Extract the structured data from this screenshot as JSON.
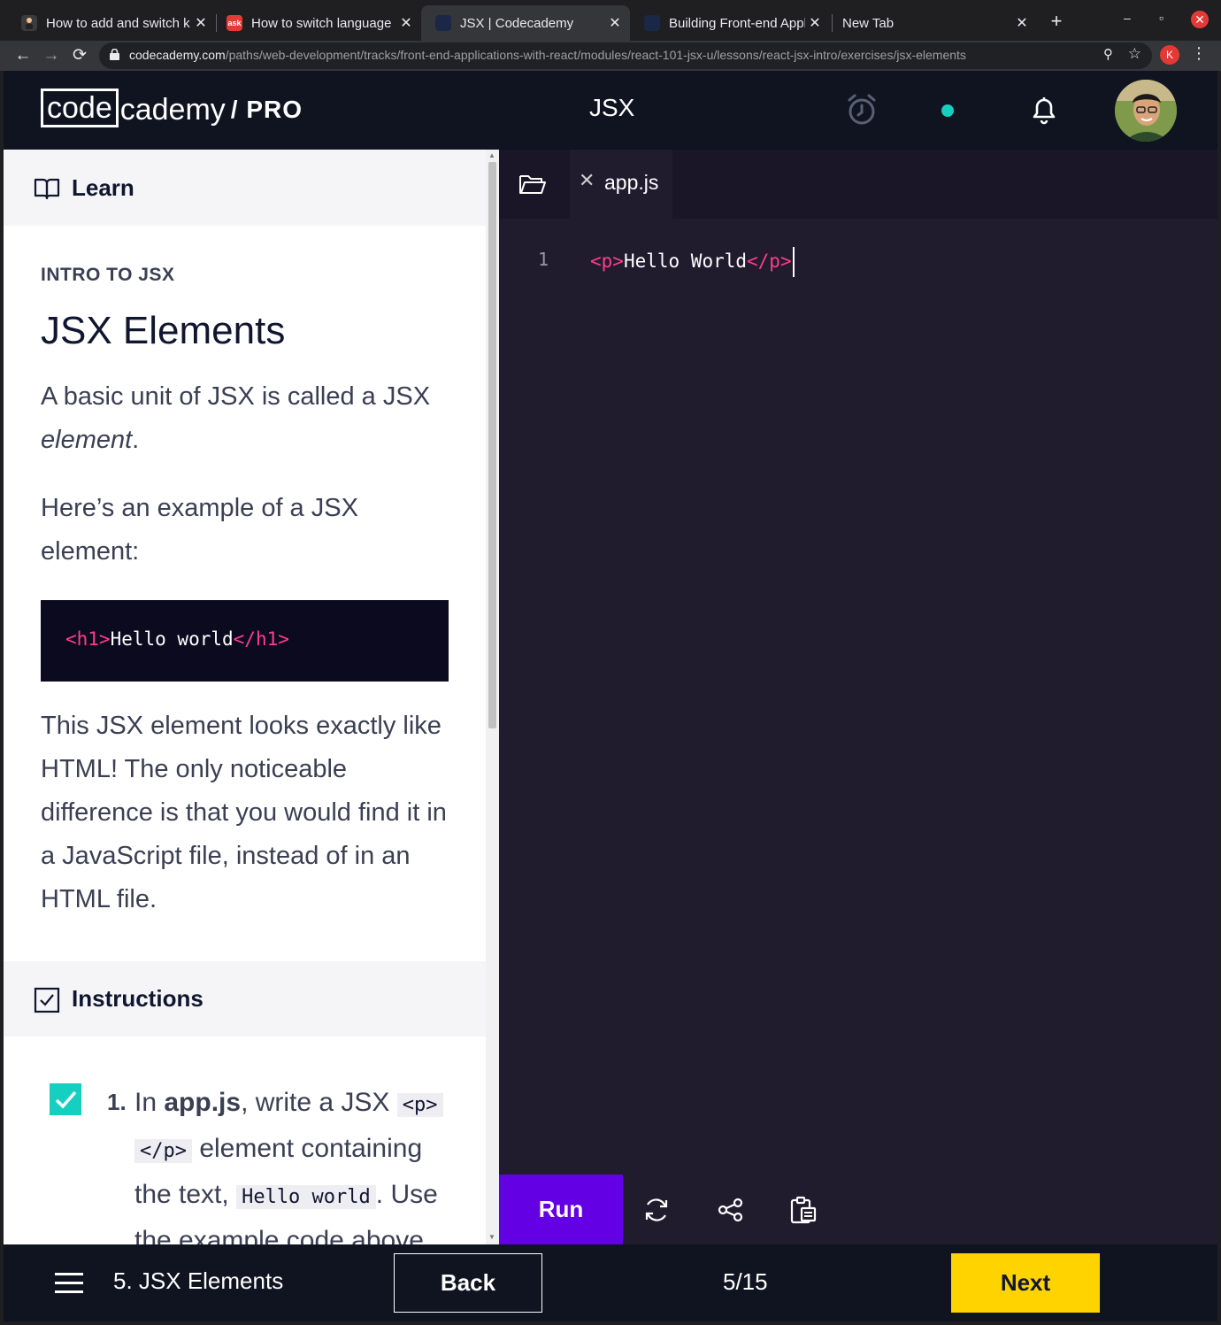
{
  "browser": {
    "tabs": [
      {
        "title": "How to add and switch k",
        "favicon": "person-favicon",
        "favicon_color": "#3b3b3b"
      },
      {
        "title": "How to switch language",
        "favicon": "ask-favicon",
        "favicon_color": "#e53935"
      },
      {
        "title": "JSX | Codecademy",
        "favicon": "codecademy-favicon",
        "favicon_color": "#1b2746",
        "active": true
      },
      {
        "title": "Building Front-end Appl",
        "favicon": "codecademy-favicon",
        "favicon_color": "#1b2746"
      },
      {
        "title": "New Tab",
        "favicon": "",
        "favicon_color": ""
      }
    ],
    "url_host": "codecademy.com",
    "url_path": "/paths/web-development/tracks/front-end-applications-with-react/modules/react-101-jsx-u/lessons/react-jsx-intro/exercises/jsx-elements",
    "profile_initial": "K"
  },
  "header": {
    "logo_code": "code",
    "logo_cademy": "cademy",
    "logo_pro": "/ PRO",
    "title": "JSX"
  },
  "learn": {
    "section_label": "Learn",
    "kicker": "INTRO TO JSX",
    "title": "JSX Elements",
    "p1_a": "A basic unit of JSX is called a JSX",
    "p1_em": "element",
    "p1_b": ".",
    "p2": "Here’s an example of a JSX element:",
    "example_open": "<h1>",
    "example_text": "Hello world",
    "example_close": "</h1>",
    "p3": "This JSX element looks exactly like HTML! The only noticeable difference is that you would find it in a JavaScript file, instead of in an HTML file."
  },
  "instructions": {
    "section_label": "Instructions",
    "step_number": "1.",
    "step_text_1": "In ",
    "step_file": "app.js",
    "step_text_2": ", write a JSX ",
    "step_code_1": "<p>",
    "step_code_2": "</p>",
    "step_text_3": " element containing the text, ",
    "step_code_3": "Hello world",
    "step_text_4": ". Use the example code above",
    "completed": true
  },
  "editor": {
    "file_name": "app.js",
    "line_number": "1",
    "code_open": "<p>",
    "code_text": "Hello World",
    "code_close": "</p>",
    "run_label": "Run"
  },
  "bottom": {
    "lesson_name": "5. JSX Elements",
    "back_label": "Back",
    "progress": "5/15",
    "next_label": "Next"
  },
  "colors": {
    "accent_run": "#6400e4",
    "next_button": "#ffd300",
    "jsx_tag": "#ff3d8b",
    "status_dot": "#15d0c0"
  }
}
